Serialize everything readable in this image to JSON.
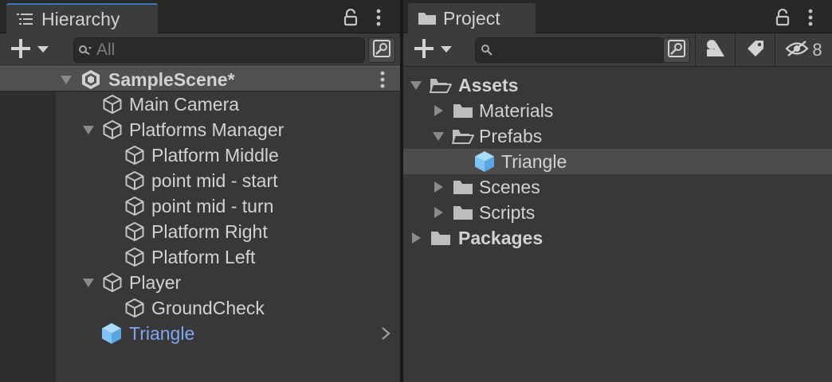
{
  "hierarchy": {
    "tab_label": "Hierarchy",
    "search_placeholder": "All",
    "scene": {
      "label": "SampleScene*"
    },
    "items": [
      {
        "label": "Main Camera"
      },
      {
        "label": "Platforms Manager"
      },
      {
        "label": "Platform Middle"
      },
      {
        "label": "point mid - start"
      },
      {
        "label": "point mid - turn"
      },
      {
        "label": "Platform Right"
      },
      {
        "label": "Platform Left"
      },
      {
        "label": "Player"
      },
      {
        "label": "GroundCheck"
      },
      {
        "label": "Triangle"
      }
    ]
  },
  "project": {
    "tab_label": "Project",
    "search_placeholder": "",
    "hidden_count": "8",
    "tree": [
      {
        "label": "Assets"
      },
      {
        "label": "Materials"
      },
      {
        "label": "Prefabs"
      },
      {
        "label": "Triangle"
      },
      {
        "label": "Scenes"
      },
      {
        "label": "Scripts"
      },
      {
        "label": "Packages"
      }
    ]
  },
  "colors": {
    "prefab_blue": "#7fc4f4",
    "prefab_label": "#7fa7ef",
    "tab_accent": "#3a79bb"
  }
}
